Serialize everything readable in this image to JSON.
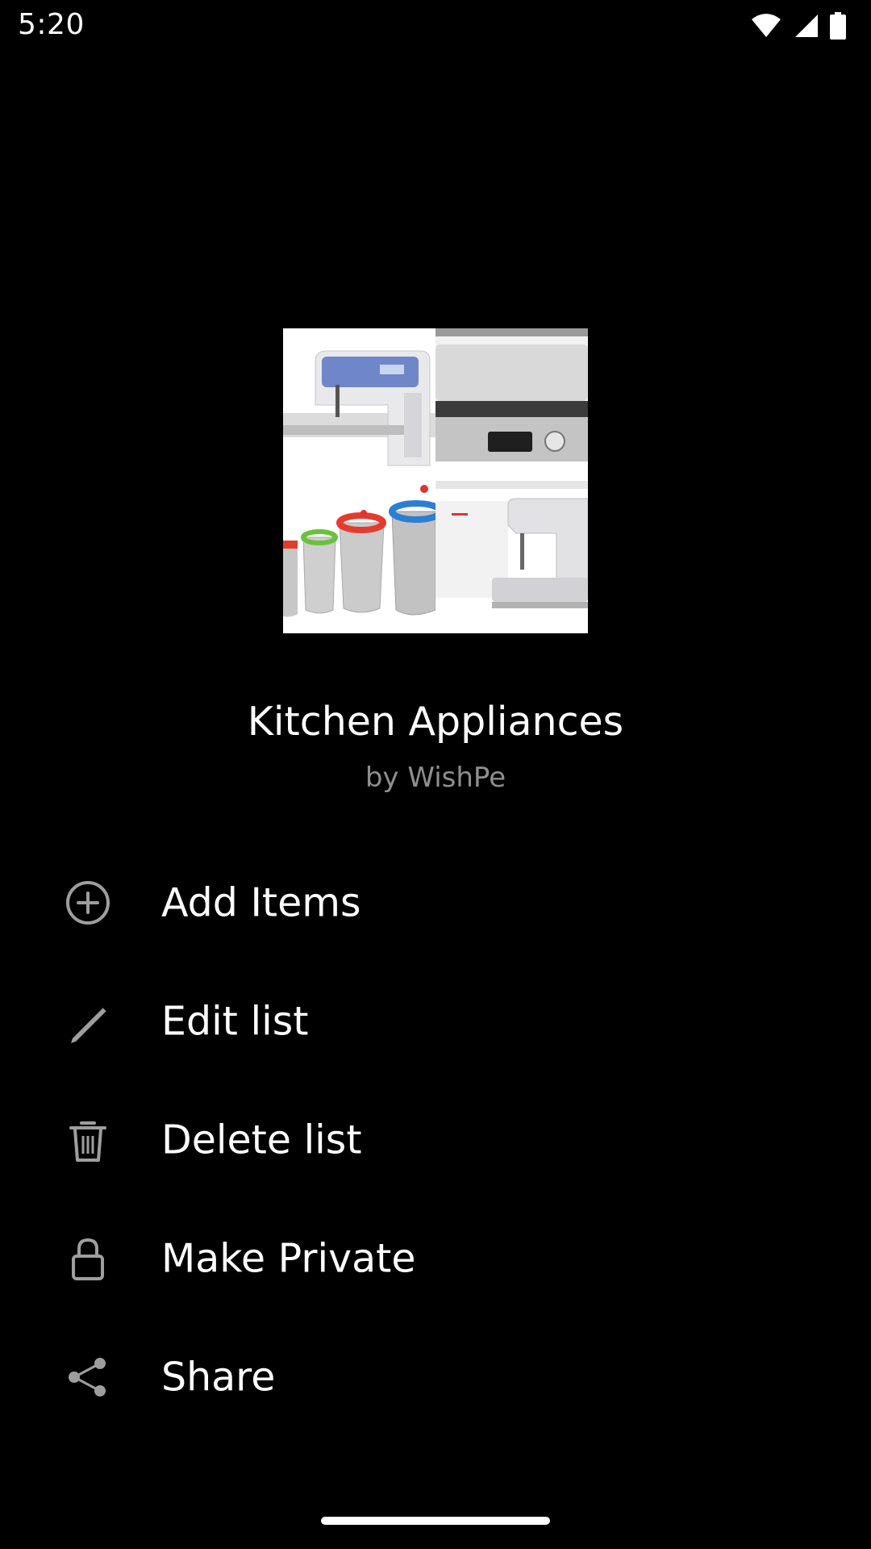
{
  "status_bar": {
    "time": "5:20",
    "icons": [
      "wifi-icon",
      "signal-icon",
      "battery-icon"
    ]
  },
  "cover": {
    "tiles": [
      "sewing-machine-photo",
      "grill-appliance-photo",
      "mesh-bags-photo",
      "sewing-machine-photo"
    ]
  },
  "list": {
    "title": "Kitchen Appliances",
    "owner": "by WishPe"
  },
  "menu": {
    "items": [
      {
        "label": "Add Items",
        "icon": "add-circle-icon"
      },
      {
        "label": "Edit list",
        "icon": "pencil-icon"
      },
      {
        "label": "Delete list",
        "icon": "trash-icon"
      },
      {
        "label": "Make Private",
        "icon": "lock-icon"
      },
      {
        "label": "Share",
        "icon": "share-icon"
      }
    ]
  },
  "colors": {
    "background": "#000000",
    "text": "#ffffff",
    "muted_text": "#8e8e8e",
    "icon": "#9e9e9e"
  }
}
